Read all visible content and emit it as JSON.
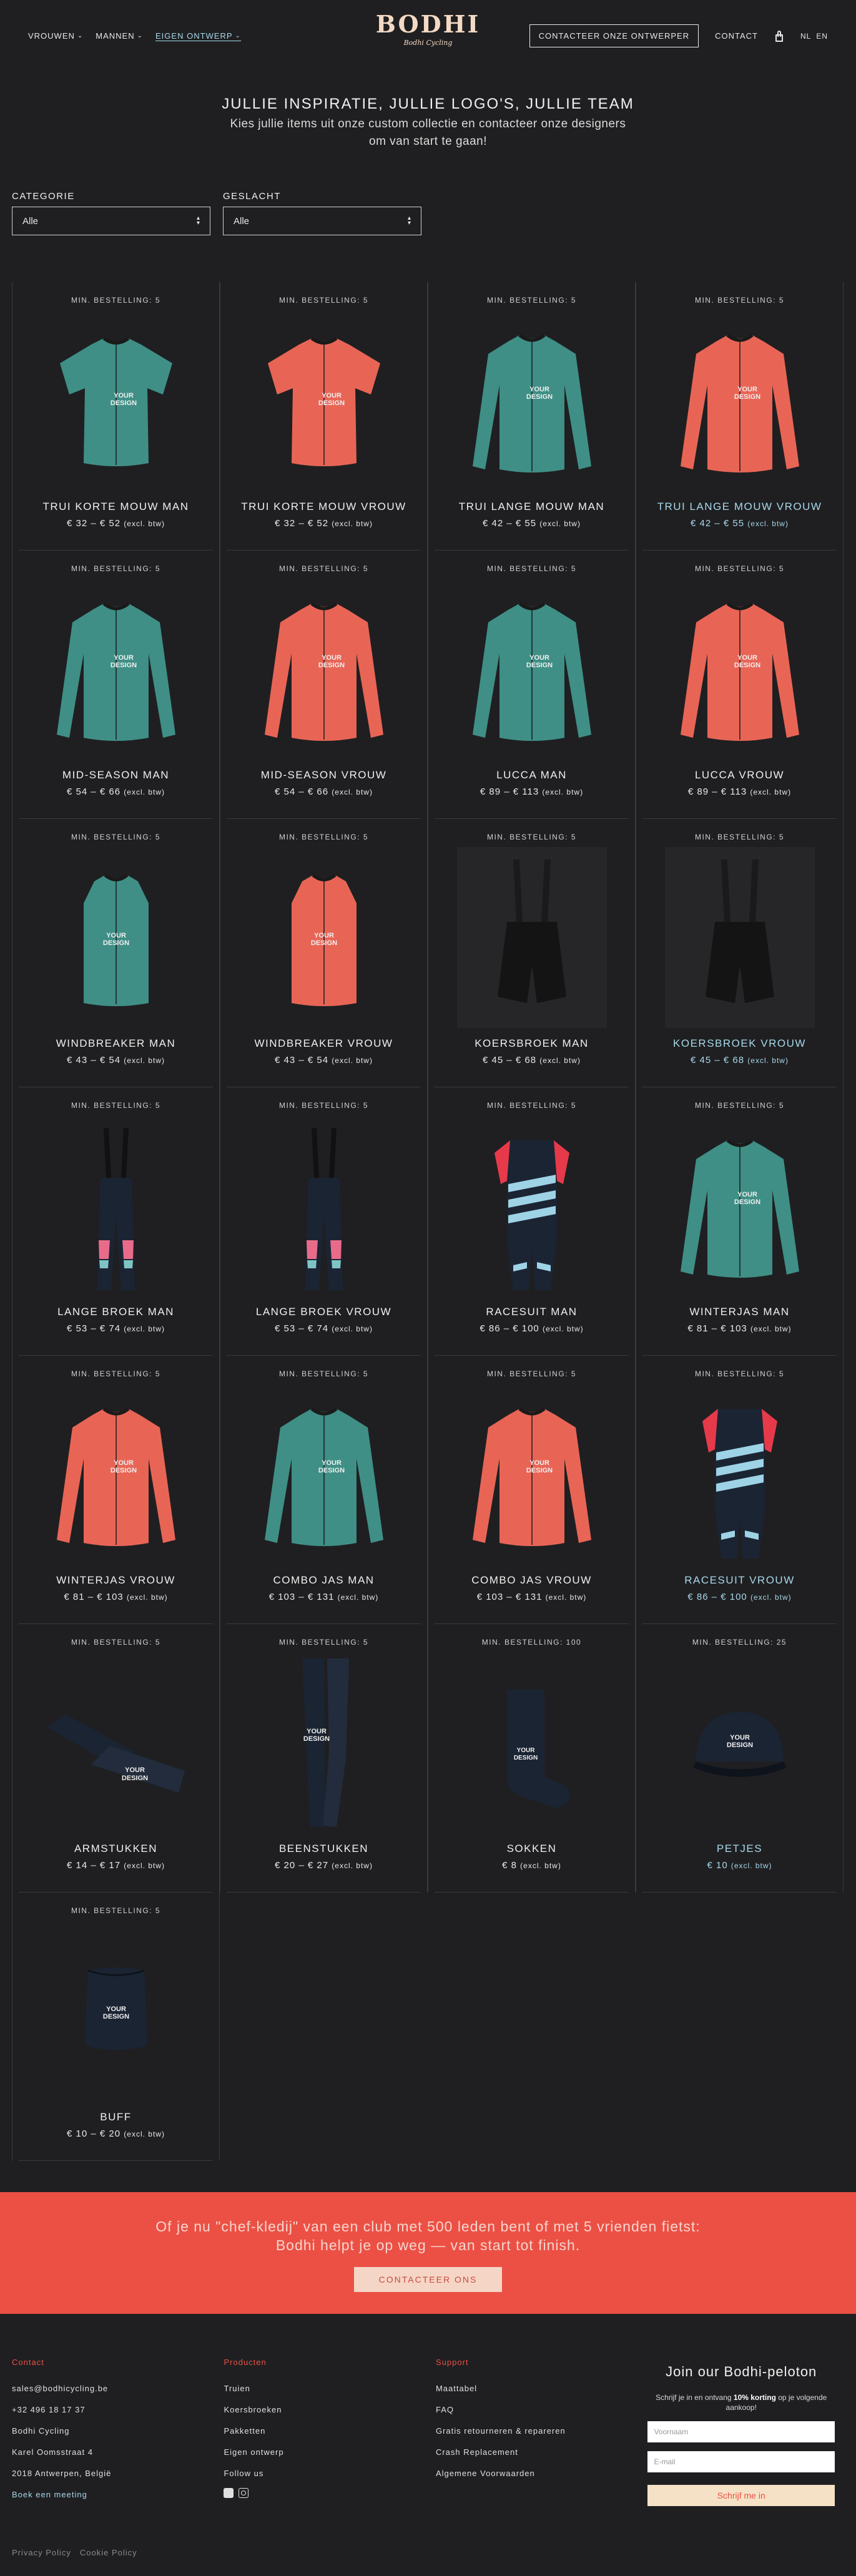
{
  "header": {
    "nav": [
      {
        "label": "VROUWEN",
        "caret": true,
        "active": false
      },
      {
        "label": "MANNEN",
        "caret": true,
        "active": false
      },
      {
        "label": "EIGEN ONTWERP",
        "caret": true,
        "active": true
      }
    ],
    "logo": {
      "word": "BODHI",
      "sub": "Bodhi Cycling"
    },
    "contact_designer": "CONTACTEER ONZE ONTWERPER",
    "contact": "CONTACT",
    "languages": [
      "NL",
      "EN"
    ]
  },
  "intro": {
    "title": "JULLIE INSPIRATIE, JULLIE LOGO'S, JULLIE TEAM",
    "text": "Kies jullie items uit onze custom collectie en contacteer onze designers om van start te gaan!"
  },
  "filters": {
    "category": {
      "label": "CATEGORIE",
      "value": "Alle"
    },
    "gender": {
      "label": "GESLACHT",
      "value": "Alle"
    }
  },
  "products": [
    {
      "min": "MIN. BESTELLING: 5",
      "name": "TRUI KORTE MOUW MAN",
      "price": "€ 32 – € 52",
      "vat": "(excl. btw)",
      "type": "jersey-short",
      "color": "#3f8f86",
      "highlight": false
    },
    {
      "min": "MIN. BESTELLING: 5",
      "name": "TRUI KORTE MOUW VROUW",
      "price": "€ 32 – € 52",
      "vat": "(excl. btw)",
      "type": "jersey-short",
      "color": "#e86556",
      "highlight": false
    },
    {
      "min": "MIN. BESTELLING: 5",
      "name": "TRUI LANGE MOUW MAN",
      "price": "€ 42 – € 55",
      "vat": "(excl. btw)",
      "type": "jersey-long",
      "color": "#3f8f86",
      "highlight": false
    },
    {
      "min": "MIN. BESTELLING: 5",
      "name": "TRUI LANGE MOUW VROUW",
      "price": "€ 42 – € 55",
      "vat": "(excl. btw)",
      "type": "jersey-long",
      "color": "#e86556",
      "highlight": true
    },
    {
      "min": "MIN. BESTELLING: 5",
      "name": "MID-SEASON MAN",
      "price": "€ 54 – € 66",
      "vat": "(excl. btw)",
      "type": "jersey-long",
      "color": "#3f8f86",
      "highlight": false
    },
    {
      "min": "MIN. BESTELLING: 5",
      "name": "MID-SEASON VROUW",
      "price": "€ 54 – € 66",
      "vat": "(excl. btw)",
      "type": "jersey-long",
      "color": "#e86556",
      "highlight": false
    },
    {
      "min": "MIN. BESTELLING: 5",
      "name": "LUCCA MAN",
      "price": "€ 89 – € 113",
      "vat": "(excl. btw)",
      "type": "jersey-long",
      "color": "#3f8f86",
      "highlight": false
    },
    {
      "min": "MIN. BESTELLING: 5",
      "name": "LUCCA VROUW",
      "price": "€ 89 – € 113",
      "vat": "(excl. btw)",
      "type": "jersey-long",
      "color": "#e86556",
      "highlight": false
    },
    {
      "min": "MIN. BESTELLING: 5",
      "name": "WINDBREAKER MAN",
      "price": "€ 43 – € 54",
      "vat": "(excl. btw)",
      "type": "vest",
      "color": "#3f8f86",
      "highlight": false
    },
    {
      "min": "MIN. BESTELLING: 5",
      "name": "WINDBREAKER VROUW",
      "price": "€ 43 – € 54",
      "vat": "(excl. btw)",
      "type": "vest",
      "color": "#e86556",
      "highlight": false
    },
    {
      "min": "MIN. BESTELLING: 5",
      "name": "KOERSBROEK MAN",
      "price": "€ 45 – € 68",
      "vat": "(excl. btw)",
      "type": "bib-short",
      "color": "#2a2a2c",
      "highlight": false
    },
    {
      "min": "MIN. BESTELLING: 5",
      "name": "KOERSBROEK VROUW",
      "price": "€ 45 – € 68",
      "vat": "(excl. btw)",
      "type": "bib-short",
      "color": "#2a2a2c",
      "highlight": true
    },
    {
      "min": "MIN. BESTELLING: 5",
      "name": "LANGE BROEK MAN",
      "price": "€ 53 – € 74",
      "vat": "(excl. btw)",
      "type": "bib-long",
      "color": "#1b2433",
      "highlight": false
    },
    {
      "min": "MIN. BESTELLING: 5",
      "name": "LANGE BROEK VROUW",
      "price": "€ 53 – € 74",
      "vat": "(excl. btw)",
      "type": "bib-long",
      "color": "#1b2433",
      "highlight": false
    },
    {
      "min": "MIN. BESTELLING: 5",
      "name": "RACESUIT MAN",
      "price": "€ 86 – € 100",
      "vat": "(excl. btw)",
      "type": "suit",
      "color": "#1b2433",
      "highlight": false
    },
    {
      "min": "MIN. BESTELLING: 5",
      "name": "WINTERJAS MAN",
      "price": "€ 81 – € 103",
      "vat": "(excl. btw)",
      "type": "jersey-long",
      "color": "#3f8f86",
      "highlight": false
    },
    {
      "min": "MIN. BESTELLING: 5",
      "name": "WINTERJAS VROUW",
      "price": "€ 81 – € 103",
      "vat": "(excl. btw)",
      "type": "jersey-long",
      "color": "#e86556",
      "highlight": false
    },
    {
      "min": "MIN. BESTELLING: 5",
      "name": "COMBO JAS MAN",
      "price": "€ 103 – € 131",
      "vat": "(excl. btw)",
      "type": "jersey-long",
      "color": "#3f8f86",
      "highlight": false
    },
    {
      "min": "MIN. BESTELLING: 5",
      "name": "COMBO JAS VROUW",
      "price": "€ 103 – € 131",
      "vat": "(excl. btw)",
      "type": "jersey-long",
      "color": "#e86556",
      "highlight": false
    },
    {
      "min": "MIN. BESTELLING: 5",
      "name": "RACESUIT VROUW",
      "price": "€ 86 – € 100",
      "vat": "(excl. btw)",
      "type": "suit",
      "color": "#1b2433",
      "highlight": true
    },
    {
      "min": "MIN. BESTELLING: 5",
      "name": "ARMSTUKKEN",
      "price": "€ 14 – € 17",
      "vat": "(excl. btw)",
      "type": "arms",
      "color": "#1b2433",
      "highlight": false
    },
    {
      "min": "MIN. BESTELLING: 5",
      "name": "BEENSTUKKEN",
      "price": "€ 20 – € 27",
      "vat": "(excl. btw)",
      "type": "legs",
      "color": "#1b2433",
      "highlight": false
    },
    {
      "min": "MIN. BESTELLING: 100",
      "name": "SOKKEN",
      "price": "€ 8",
      "vat": "(excl. btw)",
      "type": "sock",
      "color": "#1b2433",
      "highlight": false
    },
    {
      "min": "MIN. BESTELLING: 25",
      "name": "PETJES",
      "price": "€ 10",
      "vat": "(excl. btw)",
      "type": "cap",
      "color": "#1b2433",
      "highlight": true
    },
    {
      "min": "MIN. BESTELLING: 5",
      "name": "BUFF",
      "price": "€ 10 – € 20",
      "vat": "(excl. btw)",
      "type": "buff",
      "color": "#1b2433",
      "highlight": false
    }
  ],
  "design_text": [
    "YOUR",
    "DESIGN"
  ],
  "banner": {
    "line1": "Of je nu \"chef-kledij\" van een club met 500 leden bent of met 5 vrienden fietst:",
    "line2": "Bodhi helpt je op weg — van start tot finish.",
    "button": "CONTACTEER ONS"
  },
  "footer": {
    "contact": {
      "title": "Contact",
      "items": [
        "sales@bodhicycling.be",
        "+32 496 18 17 37",
        "Bodhi Cycling",
        "Karel Oomsstraat 4",
        "2018 Antwerpen, België"
      ],
      "link": "Boek een meeting"
    },
    "products": {
      "title": "Producten",
      "items": [
        "Truien",
        "Koersbroeken",
        "Pakketten",
        "Eigen ontwerp",
        "Follow us"
      ]
    },
    "support": {
      "title": "Support",
      "items": [
        "Maattabel",
        "FAQ",
        "Gratis retourneren & repareren",
        "Crash Replacement",
        "Algemene Voorwaarden"
      ]
    },
    "newsletter": {
      "title": "Join our Bodhi-peloton",
      "text_pre": "Schrijf je in en ontvang ",
      "text_bold": "10% korting",
      "text_post": " op je volgende aankoop!",
      "name_placeholder": "Voornaam",
      "email_placeholder": "E-mail",
      "button": "Schrijf me in"
    },
    "bottom": [
      "Privacy Policy",
      "Cookie Policy"
    ]
  },
  "colors": {
    "accent": "#ec5044",
    "link": "#a8d8ea",
    "teal": "#3f8f86",
    "coral": "#e86556",
    "logo": "#f3d9c4"
  }
}
